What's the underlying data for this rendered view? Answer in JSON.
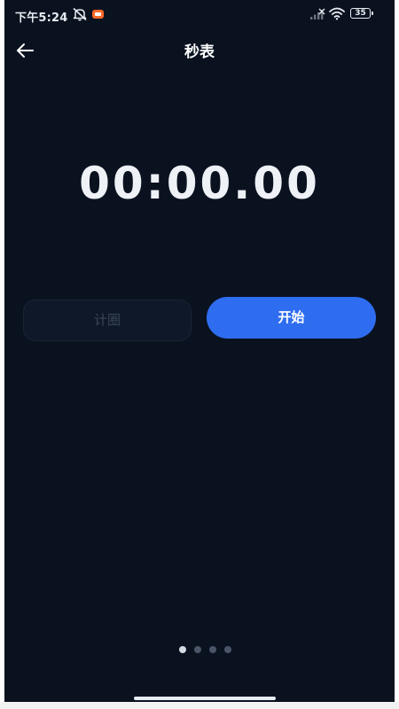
{
  "status_bar": {
    "time": "下午5:24",
    "battery": "35",
    "icons": [
      "mute-icon",
      "screen-record-icon",
      "signal-icon",
      "wifi-icon",
      "battery-icon"
    ]
  },
  "header": {
    "title": "秒表",
    "back_icon": "arrow-left-icon"
  },
  "stopwatch": {
    "display": "00:00.00"
  },
  "buttons": {
    "lap_label": "计圈",
    "start_label": "开始"
  },
  "pager": {
    "count": 4,
    "active_index": 0
  },
  "colors": {
    "background": "#0a1220",
    "accent": "#2f6df0",
    "text": "#ffffff",
    "disabled_text": "#3a4558"
  }
}
